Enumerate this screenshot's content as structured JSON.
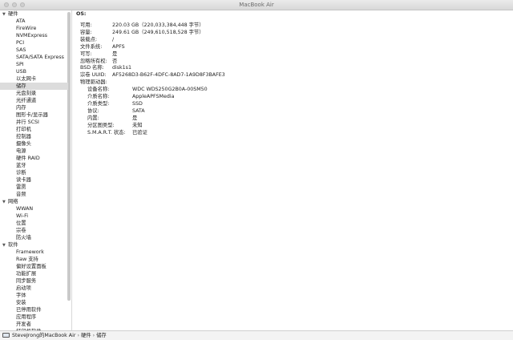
{
  "window": {
    "title": "MacBook Air"
  },
  "sidebar": {
    "groups": [
      {
        "label": "硬件",
        "items": [
          "ATA",
          "FireWire",
          "NVMExpress",
          "PCI",
          "SAS",
          "SATA/SATA Express",
          "SPI",
          "USB",
          "以太网卡",
          "储存",
          "光盘刻录",
          "光纤通道",
          "内存",
          "图形卡/显示器",
          "并行 SCSI",
          "打印机",
          "控制器",
          "摄像头",
          "电源",
          "硬件 RAID",
          "蓝牙",
          "诊断",
          "读卡器",
          "雷雳",
          "音频"
        ]
      },
      {
        "label": "网络",
        "items": [
          "WWAN",
          "Wi-Fi",
          "位置",
          "宗卷",
          "防火墙"
        ]
      },
      {
        "label": "软件",
        "items": [
          "Framework",
          "Raw 支持",
          "偏好设置面板",
          "功能扩展",
          "同步服务",
          "启动项",
          "字体",
          "安装",
          "已停用软件",
          "应用程序",
          "开发者",
          "打印机软件"
        ]
      }
    ],
    "selected": "储存"
  },
  "detail": {
    "os_label": "OS:",
    "fields": [
      {
        "key": "可用:",
        "value": "220.03 GB（220,033,384,448 字节）"
      },
      {
        "key": "容量:",
        "value": "249.61 GB（249,610,518,528 字节）"
      },
      {
        "key": "装载点:",
        "value": "/"
      },
      {
        "key": "文件系统:",
        "value": "APFS"
      },
      {
        "key": "可写:",
        "value": "是"
      },
      {
        "key": "忽略所有权:",
        "value": "否"
      },
      {
        "key": "BSD 名称:",
        "value": "disk1s1"
      },
      {
        "key": "宗卷 UUID:",
        "value": "AF5268D3-B62F-4DFC-8AD7-1A9D8F3BAFE3"
      },
      {
        "key": "物理驱动器:",
        "value": ""
      }
    ],
    "drive_fields": [
      {
        "key": "设备名称:",
        "value": "WDC WDS250G2B0A-00SM50"
      },
      {
        "key": "介质名称:",
        "value": "AppleAPFSMedia"
      },
      {
        "key": "介质类型:",
        "value": "SSD"
      },
      {
        "key": "协议:",
        "value": "SATA"
      },
      {
        "key": "内置:",
        "value": "是"
      },
      {
        "key": "分区图类型:",
        "value": "未知"
      },
      {
        "key": "S.M.A.R.T. 状态:",
        "value": "已验证"
      }
    ]
  },
  "statusbar": {
    "crumbs": [
      "SteveJrong的MacBook Air",
      "硬件",
      "储存"
    ],
    "separator": "›"
  }
}
